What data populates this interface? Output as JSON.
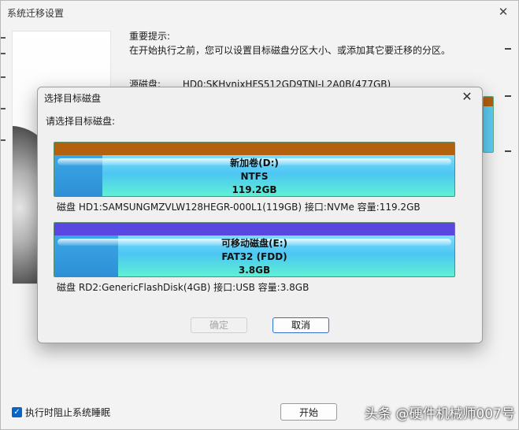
{
  "main_window": {
    "title": "系统迁移设置",
    "close_glyph": "✕",
    "tip_heading": "重要提示:",
    "tip_text": "在开始执行之前，您可以设置目标磁盘分区大小、或添加其它要迁移的分区。",
    "source_label": "源磁盘:",
    "source_value": "HD0:SKHynixHFS512GD9TNI-L2A0B(477GB)",
    "prevent_sleep_label": "执行时阻止系统睡眠",
    "prevent_sleep_checked": true,
    "start_button": "开始"
  },
  "dialog": {
    "title": "选择目标磁盘",
    "close_glyph": "✕",
    "prompt": "请选择目标磁盘:",
    "disks": [
      {
        "name": "新加卷(D:)",
        "filesystem": "NTFS",
        "size": "119.2GB",
        "info": "磁盘 HD1:SAMSUNGMZVLW128HEGR-000L1(119GB)  接口:NVMe  容量:119.2GB",
        "cap_color": "#b3600f",
        "used_fraction": 0.12
      },
      {
        "name": "可移动磁盘(E:)",
        "filesystem": "FAT32 (FDD)",
        "size": "3.8GB",
        "info": "磁盘 RD2:GenericFlashDisk(4GB)  接口:USB  容量:3.8GB",
        "cap_color": "#5a46e0",
        "used_fraction": 0.16
      }
    ],
    "ok_button": "确定",
    "cancel_button": "取消"
  },
  "watermark": "头条 @硬件机械师007号"
}
